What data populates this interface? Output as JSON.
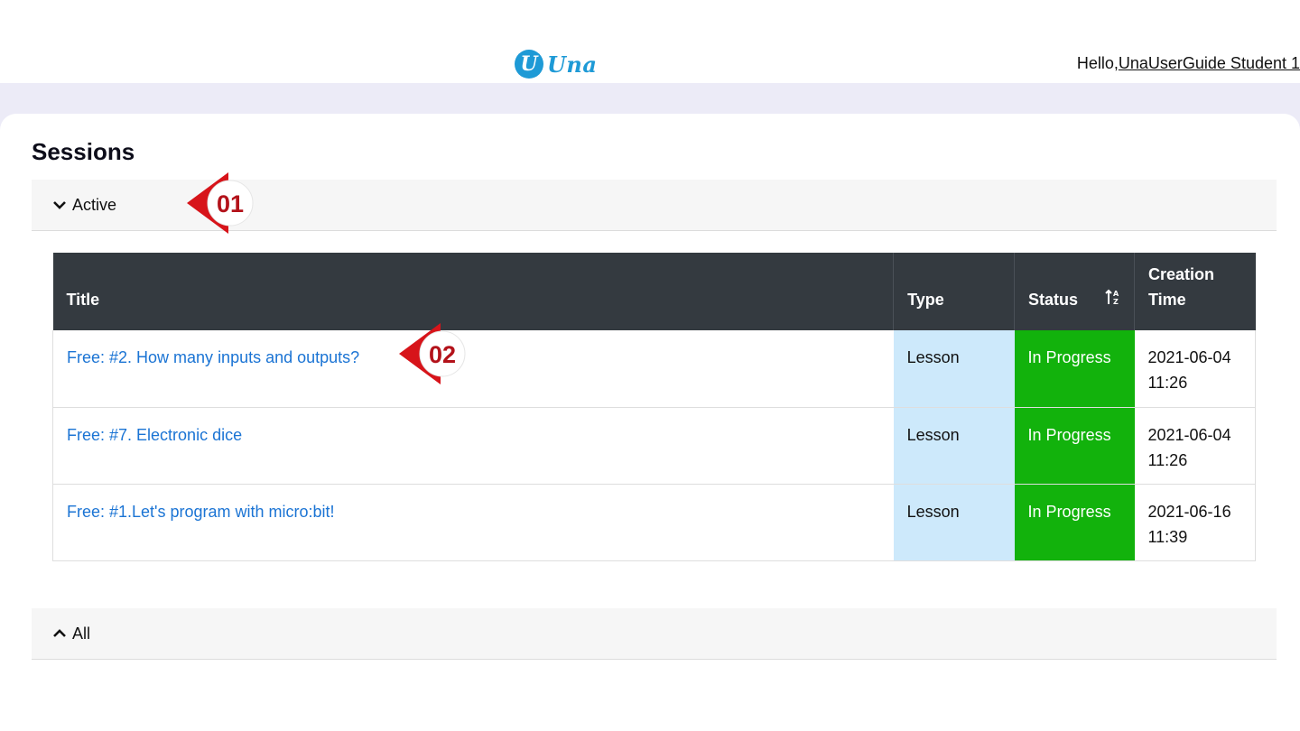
{
  "header": {
    "logo_text": "Una",
    "logo_mark": "U",
    "greeting_prefix": "Hello,",
    "user_name": "UnaUserGuide Student 1"
  },
  "page": {
    "title": "Sessions"
  },
  "accordions": {
    "active": {
      "label": "Active",
      "state": "expanded"
    },
    "all": {
      "label": "All",
      "state": "collapsed"
    }
  },
  "table": {
    "columns": {
      "title": "Title",
      "type": "Type",
      "status": "Status",
      "creation_time_line1": "Creation",
      "creation_time_line2": "Time"
    },
    "rows": [
      {
        "title": "Free: #2. How many inputs and outputs?",
        "type": "Lesson",
        "status": "In Progress",
        "date": "2021-06-04",
        "time": "11:26"
      },
      {
        "title": "Free: #7. Electronic dice",
        "type": "Lesson",
        "status": "In Progress",
        "date": "2021-06-04",
        "time": "11:26"
      },
      {
        "title": "Free: #1.Let's program with micro:bit!",
        "type": "Lesson",
        "status": "In Progress",
        "date": "2021-06-16",
        "time": "11:39"
      }
    ]
  },
  "callouts": {
    "first": "01",
    "second": "02"
  },
  "colors": {
    "brand": "#1e9ad6",
    "link": "#1b74d4",
    "header_bg": "#343a40",
    "type_bg": "#cde9fb",
    "status_bg": "#12b20c",
    "callout_red": "#d7141a"
  },
  "icons": {
    "sort": "sort-alpha-icon",
    "expand": "chevron-down-icon",
    "collapse": "chevron-up-icon"
  }
}
